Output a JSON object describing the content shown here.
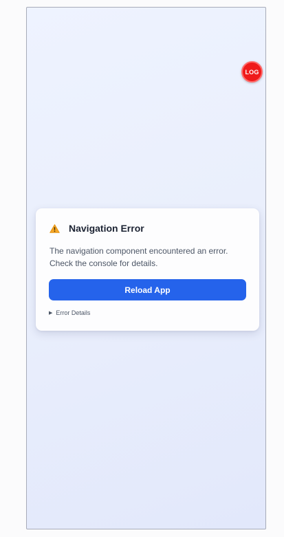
{
  "log_button": {
    "label": "LOG",
    "color": "#ef1b1b"
  },
  "error_card": {
    "icon": "warning-icon",
    "title": "Navigation Error",
    "message": "The navigation component encountered an error. Check the console for details.",
    "reload_label": "Reload App",
    "details_label": "Error Details",
    "details_icon": "triangle-right-icon"
  },
  "colors": {
    "accent": "#2563eb",
    "warning": "#f5a524"
  }
}
